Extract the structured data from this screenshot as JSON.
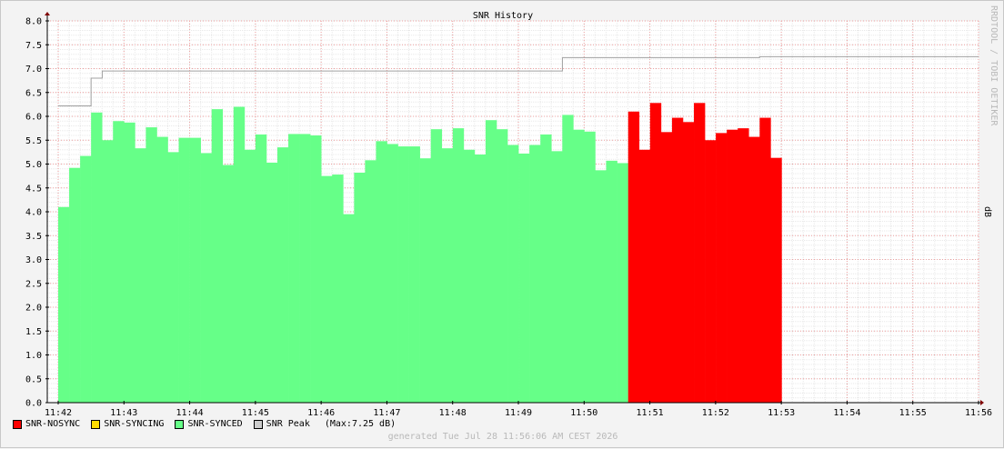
{
  "chart_data": {
    "type": "area",
    "title": "SNR History",
    "unit_label": "dB",
    "side_label": "RRDTOOL / TOBI OETIKER",
    "y_ticks": [
      "0.0",
      "0.5",
      "1.0",
      "1.5",
      "2.0",
      "2.5",
      "3.0",
      "3.5",
      "4.0",
      "4.5",
      "5.0",
      "5.5",
      "6.0",
      "6.5",
      "7.0",
      "7.5",
      "8.0"
    ],
    "ylim": [
      0,
      8
    ],
    "x_ticks": [
      "11:42",
      "11:43",
      "11:44",
      "11:45",
      "11:46",
      "11:47",
      "11:48",
      "11:49",
      "11:50",
      "11:51",
      "11:52",
      "11:53",
      "11:54",
      "11:55",
      "11:56"
    ],
    "xlim_minutes": [
      0,
      14
    ],
    "grid": true,
    "step_minutes": 0.1667,
    "series": [
      {
        "name": "SNR-SYNCED",
        "color": "#66ff88",
        "start_minute": 0,
        "values": [
          4.1,
          4.92,
          5.17,
          6.08,
          5.5,
          5.9,
          5.87,
          5.33,
          5.77,
          5.57,
          5.25,
          5.55,
          5.55,
          5.23,
          6.15,
          4.98,
          6.2,
          5.3,
          5.62,
          5.03,
          5.35,
          5.63,
          5.63,
          5.6,
          4.75,
          4.78,
          3.95,
          4.82,
          5.08,
          5.48,
          5.42,
          5.37,
          5.37,
          5.12,
          5.73,
          5.33,
          5.75,
          5.3,
          5.2,
          5.92,
          5.73,
          5.4,
          5.22,
          5.4,
          5.62,
          5.27,
          6.03,
          5.72,
          5.68,
          4.87,
          5.07,
          5.02
        ]
      },
      {
        "name": "SNR-NOSYNC",
        "color": "#ff0000",
        "start_minute": 8.67,
        "values": [
          6.1,
          5.3,
          6.28,
          5.67,
          5.97,
          5.88,
          6.28,
          5.5,
          5.65,
          5.72,
          5.75,
          5.57,
          5.97,
          5.13
        ]
      },
      {
        "name": "SNR-SYNCING",
        "color": "#ffdd00",
        "values": []
      }
    ],
    "peak": {
      "name": "SNR Peak",
      "max_text": "(Max:7.25 dB)",
      "color": "#a0a0a0",
      "points": [
        [
          0,
          6.22
        ],
        [
          0.5,
          6.22
        ],
        [
          0.5,
          6.8
        ],
        [
          0.67,
          6.8
        ],
        [
          0.67,
          6.95
        ],
        [
          7.67,
          6.95
        ],
        [
          7.67,
          7.23
        ],
        [
          10.67,
          7.23
        ],
        [
          10.67,
          7.25
        ],
        [
          14,
          7.25
        ]
      ]
    },
    "legend": [
      {
        "label": "SNR-NOSYNC",
        "color": "#ff0000"
      },
      {
        "label": "SNR-SYNCING",
        "color": "#ffdd00"
      },
      {
        "label": "SNR-SYNCED",
        "color": "#66ff88"
      },
      {
        "label": "SNR Peak",
        "color": "#cccccc"
      }
    ],
    "legend_max": "(Max:7.25 dB)",
    "footer": "generated Tue Jul 28 11:56:06 AM CEST 2026"
  }
}
